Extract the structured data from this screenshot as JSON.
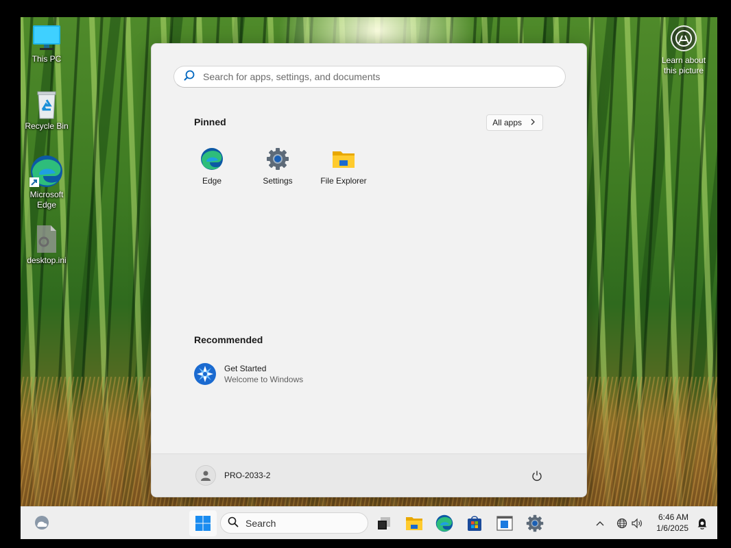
{
  "desktop": {
    "icons": [
      {
        "label": "This PC",
        "icon": "monitor-icon"
      },
      {
        "label": "Recycle Bin",
        "icon": "recycle-bin-icon"
      },
      {
        "label": "Microsoft Edge",
        "icon": "edge-icon"
      },
      {
        "label": "desktop.ini",
        "icon": "ini-file-icon"
      }
    ],
    "learn_about": {
      "line1": "Learn about",
      "line2": "this picture"
    }
  },
  "start_menu": {
    "search_placeholder": "Search for apps, settings, and documents",
    "pinned_title": "Pinned",
    "all_apps_label": "All apps",
    "pinned": [
      {
        "label": "Edge",
        "icon": "edge-icon"
      },
      {
        "label": "Settings",
        "icon": "gear-icon"
      },
      {
        "label": "File Explorer",
        "icon": "folder-icon"
      }
    ],
    "recommended_title": "Recommended",
    "recommended": [
      {
        "title": "Get Started",
        "subtitle": "Welcome to Windows",
        "icon": "get-started-icon"
      }
    ],
    "user_name": "PRO-2033-2"
  },
  "taskbar": {
    "search_label": "Search",
    "apps": [
      "task-view-icon",
      "file-explorer-icon",
      "edge-icon",
      "store-icon",
      "app-icon",
      "settings-icon"
    ],
    "clock_time": "6:46 AM",
    "clock_date": "1/6/2025"
  },
  "colors": {
    "accent": "#0067c0",
    "start_bg": "#f2f2f2",
    "taskbar_bg": "#eeeeee"
  }
}
